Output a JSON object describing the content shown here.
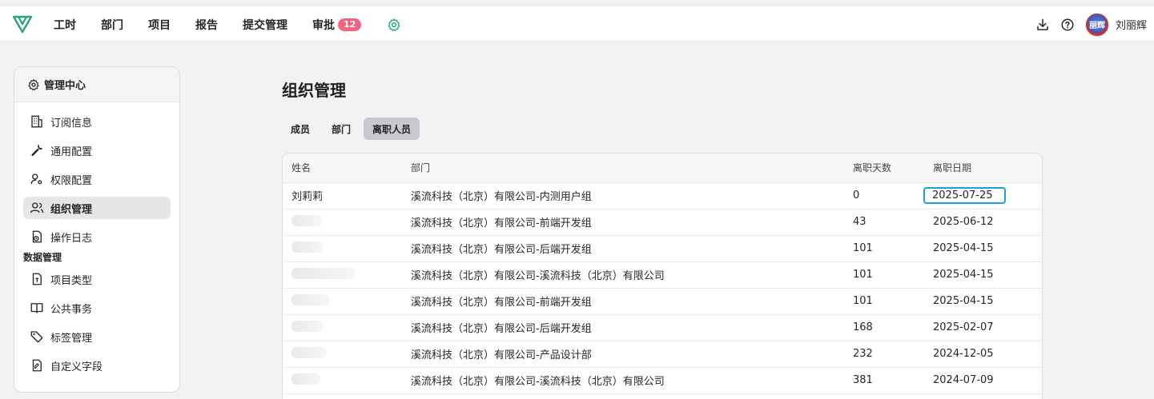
{
  "topbar": {
    "nav": [
      {
        "label": "工时"
      },
      {
        "label": "部门"
      },
      {
        "label": "项目"
      },
      {
        "label": "报告"
      },
      {
        "label": "提交管理"
      },
      {
        "label": "审批",
        "badge": "12"
      }
    ],
    "avatar_text": "丽辉",
    "username": "刘丽辉"
  },
  "sidebar": {
    "title": "管理中心",
    "items": [
      {
        "label": "订阅信息",
        "icon": "building-icon"
      },
      {
        "label": "通用配置",
        "icon": "wrench-icon"
      },
      {
        "label": "权限配置",
        "icon": "user-key-icon"
      },
      {
        "label": "组织管理",
        "icon": "users-icon",
        "active": true
      },
      {
        "label": "操作日志",
        "icon": "log-icon"
      }
    ],
    "section_label": "数据管理",
    "data_items": [
      {
        "label": "项目类型",
        "icon": "project-type-icon"
      },
      {
        "label": "公共事务",
        "icon": "book-icon"
      },
      {
        "label": "标签管理",
        "icon": "tag-icon"
      },
      {
        "label": "自定义字段",
        "icon": "custom-field-icon"
      }
    ]
  },
  "main": {
    "title": "组织管理",
    "tabs": [
      {
        "label": "成员"
      },
      {
        "label": "部门"
      },
      {
        "label": "离职人员",
        "active": true
      }
    ],
    "table": {
      "headers": [
        "姓名",
        "部门",
        "离职天数",
        "离职日期"
      ],
      "rows": [
        {
          "name": "刘莉莉",
          "dept": "溪流科技（北京）有限公司-内测用户组",
          "days": "0",
          "date": "2025-07-25"
        },
        {
          "name": "",
          "dept": "溪流科技（北京）有限公司-前端开发组",
          "days": "43",
          "date": "2025-06-12"
        },
        {
          "name": "",
          "dept": "溪流科技（北京）有限公司-后端开发组",
          "days": "101",
          "date": "2025-04-15"
        },
        {
          "name": "",
          "dept": "溪流科技（北京）有限公司-溪流科技（北京）有限公司",
          "days": "101",
          "date": "2025-04-15"
        },
        {
          "name": "",
          "dept": "溪流科技（北京）有限公司-前端开发组",
          "days": "101",
          "date": "2025-04-15"
        },
        {
          "name": "",
          "dept": "溪流科技（北京）有限公司-后端开发组",
          "days": "168",
          "date": "2025-02-07"
        },
        {
          "name": "",
          "dept": "溪流科技（北京）有限公司-产品设计部",
          "days": "232",
          "date": "2024-12-05"
        },
        {
          "name": "",
          "dept": "溪流科技（北京）有限公司-溪流科技（北京）有限公司",
          "days": "381",
          "date": "2024-07-09"
        }
      ]
    }
  },
  "colors": {
    "accent_teal": "#2aa27a",
    "badge": "#f2637f",
    "highlight_border": "#1ba1e0"
  }
}
